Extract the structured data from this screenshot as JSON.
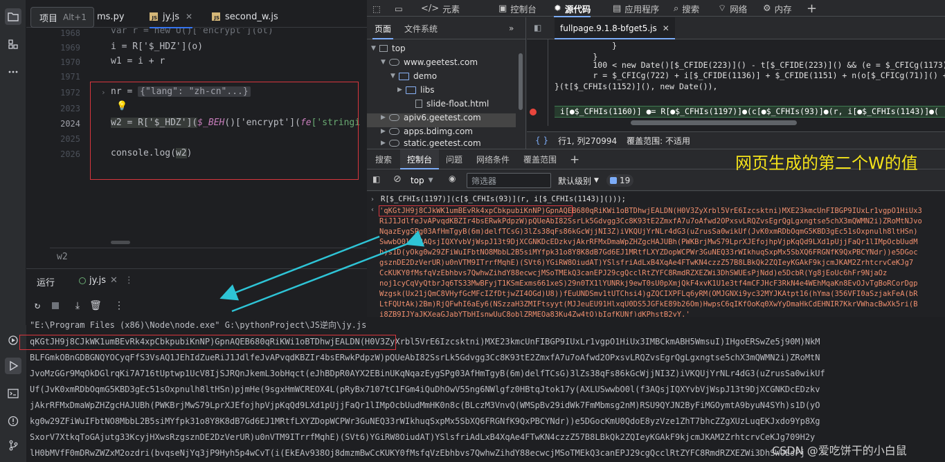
{
  "ide": {
    "tooltip": {
      "label": "项目",
      "shortcut": "Alt+1"
    },
    "tabs": [
      {
        "label": "ms.py"
      },
      {
        "label": "jy.js"
      },
      {
        "label": "second_w.js"
      }
    ],
    "line_numbers": [
      "1968",
      "1969",
      "1970",
      "1971",
      "1972",
      "2023",
      "2024",
      "2025",
      "2026"
    ],
    "code": {
      "l1968": "var r = new U()['encrypt'](ot)",
      "l1969_a": "i = R['$_HDZ'](o)",
      "l1970": "w1 = i + r",
      "l1972_kw": "nr = ",
      "l1972_fold": "{\"lang\": \"zh-cn\"...}",
      "l2024_a": "w2 = R['$_HDZ'](",
      "l2024_b": "$_BEH",
      "l2024_c": "()['encrypt'](",
      "l2024_d": "fe",
      "l2024_e": "['stringi",
      "l2026_a": "console.log(",
      "l2026_b": "w2",
      "l2026_c": ")"
    },
    "status_text": "w2",
    "run": {
      "title": "运行",
      "tab": "jy.js"
    },
    "output": [
      "\"E:\\Program Files (x86)\\Node\\node.exe\" G:\\pythonProject\\JS逆向\\jy.js",
      "qKGtJH9j8CJkWK1umBEvRk4xpCbkpubiKnNP)GpnAQEB680qRiKWi1oBTDhwjEALDN(H0V3ZyXrbl5VrE6Izcsktni)MXE23kmcUnFIBGP9IUxLr1vgpO1HiUx3IMBCkmABH5WmsuI)IHgoERSwZe5j90M)NkM",
      "BLFGmkOBnGDBGNQYOCyqFfS3VsAQ1JEhIdZueRiJ1JdlfeJvAPvqdKBZIr4bsERwkPdpzW)pQUeAbI82SsrLk5Gdvgg3Cc8K93tE2ZmxfA7u7oAfwd2OPxsvLRQZvsEgrQgLgxngtse5chX3mQWMN2i)ZRoMtN",
      "JvoMzGGr9MqOkDGlrqKi7A716tUptwp1UcV8IjSJRQnJkemL3obHqct(eJhBDpR0AYX2EBinUKqNqazEygSPg03AfHmTgyB(6m)delfTCsG)3lZs38qFs86kGcWjjNI3Z)iVKQUjYrNLr4dG3(uZrusSa0wikUf",
      "Uf(JvK0xmRDbOqmG5KBD3gEc51sOxpnulh8ltHSn)pjmHe(9sgxHmWCREOX4L(pRyBx7107tC1FGm4iQuDhOwV55ng6NWlgfz0HBtqJtok17y(AXLUSwwbO0l(f3AQsjIQXYvbVjWspJ13t9DjXCGNKDcEDzkv",
      "jAkrRFMxDmaWpZHZgcHAJUBh(PWKBrjMwS79LprXJEfojhpVjpKqQd9LXd1pUjjFaQr1lIMpOcbUudMmHK0n8c(BLczM3VnvQ(WMSpBv29idWk7FmMbmsg2nM)RSU9QYJN2ByFiMGOymtA9byuN4SYh)s1D(yO",
      "kg0w29ZFiWuIFbtNO8MbbL2B5siMYfpk31o8Y8K8dB7Gd6EJ1MRtfLXYZDopWCPWr3GuNEQ33rWIkhuqSxpMx5SbXQ6FRGNfK9QxPBCYNdr))e5DGocKmU0QdoE8yzVze1ZhT7bhcZZgXUzLuqEKJxdo9Yp8Xg",
      "SxorV7XtkqToGAjutg33KcyjHXwsRzgsznDE2DzVerUR)u0nVTM9ITrrfMqhE)(SVt6)YGiRW8OiudAT)YSlsfriAdLxB4XqAe4FTwKN4czzZ57B8LBkQk2ZQIeyKGAkF9kjcmJKAM2ZrhtcrvCeKJg709H2y",
      "lH0bMVfF0mDRwZWZxM2ozdri(bvqseNjYq3jP9Hyh5p4wCvT(i(EkEAv938Oj8dmzmBwCcKUKY0fMsfqVzEbhbvs7QwhwZihdY88ecwcjMSoTMEkQ3canEPJ29cgQcclRtZYFC8RmdRZXEZWi3DhSWUEsPj"
    ]
  },
  "devtools": {
    "top_tabs": [
      "元素",
      "控制台",
      "源代码",
      "应用程序",
      "搜索",
      "网络",
      "内存"
    ],
    "nav_tabs": [
      "页面",
      "文件系统"
    ],
    "tree": [
      "top",
      "www.geetest.com",
      "demo",
      "libs",
      "slide-float.html",
      "apiv6.geetest.com",
      "apps.bdimg.com",
      "static.geetest.com"
    ],
    "file_tab": "fullpage.9.1.8-bfget5.js",
    "source_lines": [
      "            }",
      "        }",
      "        100 < new Date()[$_CFIDE(223)]() - t[$_CFIDE(223)]() && (e = $_CFICg(1173)),",
      "        r = $_CFICg(722) + i[$_CFIDE(1136)] + $_CFIDE(1151) + n(o[$_CFICg(71)]() + n(n[$_",
      "}(t[$_CFHIs(1152)](), new Date()),",
      "i[●$_CFHIs(1160)] ●= R[●$_CFHIs(1197)]●(c[●$_CFHIs(93)]●(r, i[●$_CFHIs(1143)]●("
    ],
    "status": {
      "brace": "{ }",
      "position": "行1, 列270994",
      "coverage": "覆盖范围: 不适用"
    },
    "drawer_tabs": [
      "搜索",
      "控制台",
      "问题",
      "网络条件",
      "覆盖范围"
    ],
    "annotation": "网页生成的第二个W的值",
    "console": {
      "context": "top",
      "filter_placeholder": "筛选器",
      "level": "默认级别",
      "issues_count": "19",
      "echo": "R[$_CFHIs(1197)](c[$_CFHIs(93)](r, i[$_CFHIs(1143)]()));",
      "result_lines": [
        "'qKGtJH9j8CJkWK1umBEvRk4xpCbkpubiKnNP)GpnAQEB680qRiKWi1oBTDhwjEALDN(H0V3ZyXrbl5VrE6Izcsktni)MXE23kmcUnFIBGP9IUxLr1vgpO1HiUx3",
        "RiJ1JdlfeJvAPvqdKBZIr4bsERwkPdpzW)pQUeAbI82SsrLk5Gdvgg3Cc8K93tE2ZmxfA7u7oAfwd2OPxsvLRQZvsEgrQgLgxngtse5chX3mQWMN2i)ZRoMtNJvo",
        "NqazEygSPg03AfHmTgyB(6m)delfTCsG)3lZs38qFs86kGcWjjNI3Z)iVKQUjYrNLr4dG3(uZrusSa0wikUf(JvK0xmRDbOqmG5KBD3gEc51sOxpnulh8ltHSn)",
        "SwwbO0l(f3AQsjIQXYvbVjWspJ13t9DjXCGNKDcEDzkvjAkrRFMxDmaWpZHZgcHAJUBh(PWKBrjMwS79LprXJEfojhpVjpKqQd9LXd1pUjjFaQr1lIMpOcbUudM",
        "h)s1D(yOkg0w29ZFiWuIFbtNO8MbbL2B5siMYfpk31o8Y8K8dB7Gd6EJ1MRtfLXYZDopWCPWr3GuNEQ33rWIkhuqSxpMx5SbXQ6FRGNfK9QxPBCYNdr))e5DGoc",
        "gsznDE2DzVerUR)u0nVTM9ITrrfMqhE)(SVt6)YGiRW8OiudAT)YSlsfriAdLxB4XqAe4FTwKN4czzZ57B8LBkQk2ZQIeyKGAkF9kjcmJKAM2ZrhtcrvCeKJg7",
        "CcKUKY0fMsfqVzEbhbvs7QwhwZihdY88ecwcjMSoTMEkQ3canEPJ29cgQcclRtZYFC8RmdRZXEZWi3DhSWUEsPjNdd)e5DcbR(Yg8jEoUc6hFr9NjaOz",
        "noj1cyCqVyQtbrJq6TS33MwBFyjT1KSmExms661xeS)29n0TX1lYUNRkj9ewT0sU0pXmjQkF4xvK1U1e3tf4mCFJHcF3RkN4e4WEhMqaKn8EvOJvTgBoRCorDgp",
        "Wzgsk(Ux21jQmC8VHyfGcMFcIZfDtjwZI4OGd)U8))fEuUNDSmv1tUTChsi4)gZQCIXPFLq6yRM(OMJGNXi9yc32MYJKAtpt16(hYma(356VFI0aSzjakFeA(bR",
        "LtFQUtAk)2Bm)RjQFwhI6aEy6(NSzzaH3ZMIFtsyyt(MJJeuEU91HlxqU0DS5JGFkE89b26Om)HwpsC6qIKfOoKq0XwYyDmaHkCdEHNIR7KkrVWhacBwXk5ri(B",
        "i8ZB9IJYaJKXeaGJabYTbHIsnwUuC8oblZRMEQa83Ku4Zw4tQ)bIgfKUNf)dKPhstB2yY.'"
      ]
    }
  },
  "watermark": "CSDN @爱吃饼干的小白鼠",
  "colors": {
    "accent": "#3574f0",
    "annotation": "#f4e31a",
    "highlight_box": "#d9363e",
    "arrow": "#2ec4d6"
  }
}
